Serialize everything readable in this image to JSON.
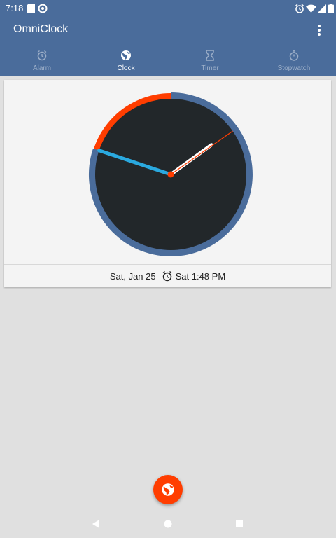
{
  "status_bar": {
    "time": "7:18",
    "icons": [
      "sd-card-icon",
      "do-not-disturb-icon",
      "alarm-icon",
      "wifi-icon",
      "signal-icon",
      "battery-icon"
    ]
  },
  "app_bar": {
    "title": "OmniClock",
    "menu_icon": "more-vert-icon",
    "color": "#4a6c9b"
  },
  "tabs": [
    {
      "label": "Alarm",
      "icon": "alarm-icon",
      "active": false
    },
    {
      "label": "Clock",
      "icon": "globe-icon",
      "active": true
    },
    {
      "label": "Timer",
      "icon": "hourglass-icon",
      "active": false
    },
    {
      "label": "Stopwatch",
      "icon": "stopwatch-icon",
      "active": false
    }
  ],
  "clock": {
    "hour": 1,
    "minute": 48,
    "second": 5,
    "face_color": "#22272a",
    "ring_color": "#ff3d00",
    "ring_progress_color": "#4a6c9b",
    "hour_hand_color": "#ffffff",
    "minute_hand_color": "#2aa9df",
    "second_hand_color": "#ff3d00"
  },
  "footer": {
    "date": "Sat, Jan 25",
    "next_alarm": "Sat 1:48 PM"
  },
  "fab": {
    "icon": "globe-icon",
    "color": "#ff3d00"
  },
  "nav_bar": {
    "icons": [
      "back-icon",
      "home-icon",
      "recents-icon"
    ]
  }
}
